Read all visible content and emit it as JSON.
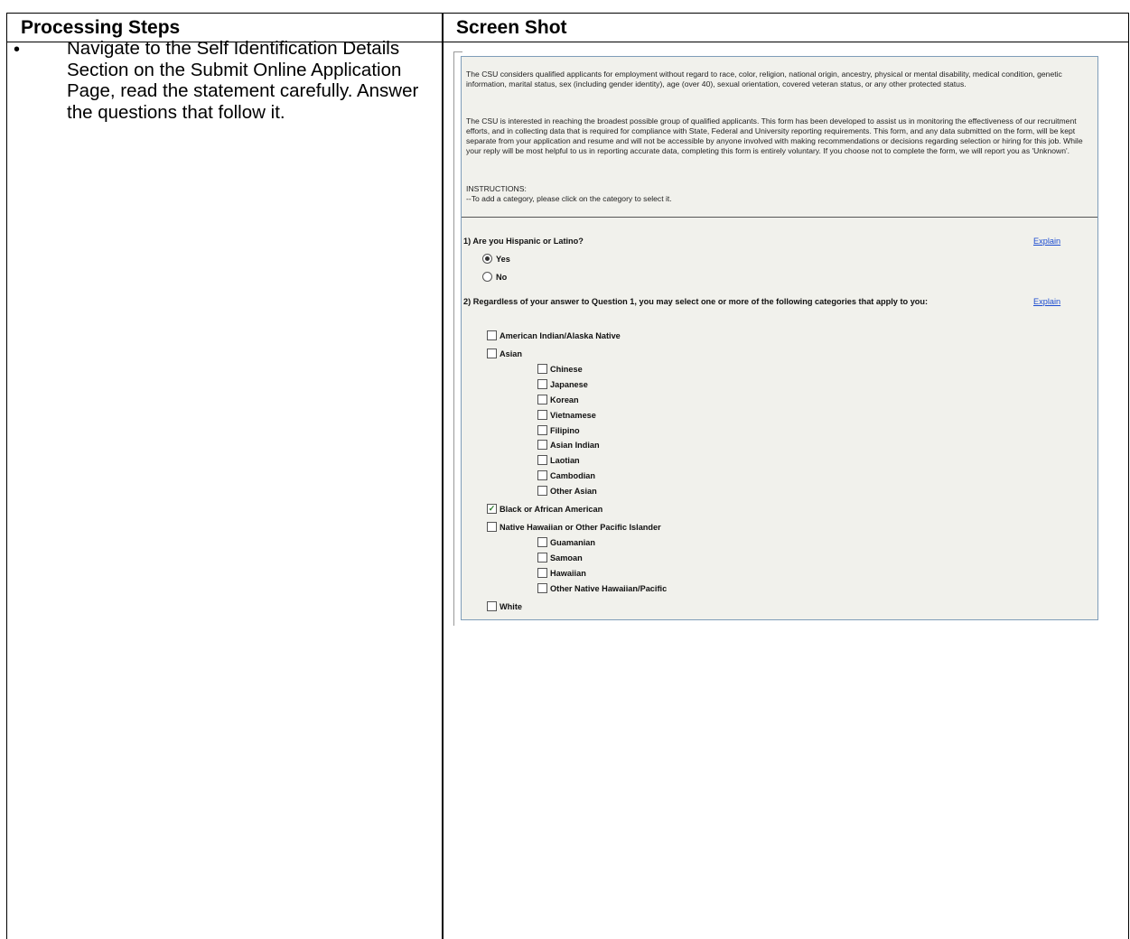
{
  "table": {
    "header_left": "Processing Steps",
    "header_right": "Screen Shot"
  },
  "step": {
    "bullet": "•",
    "text": "Navigate to the Self Identification Details Section on the Submit Online Application Page, read the statement carefully.  Answer the questions that follow it."
  },
  "form": {
    "intro_1": "The CSU considers qualified applicants for employment without regard to race, color, religion, national origin, ancestry, physical or mental disability, medical condition, genetic information, marital status, sex (including gender identity), age (over 40), sexual orientation, covered veteran status, or any other protected status.",
    "intro_2": "The CSU is interested in reaching the broadest possible group of qualified applicants. This form has been developed to assist us in monitoring the effectiveness of our recruitment efforts, and in collecting data that is required for compliance with State, Federal and University reporting requirements. This form, and any data submitted on the form, will be kept separate from your application and resume and will not be accessible by anyone involved with making recommendations or decisions regarding selection or hiring for this job. While your reply will be most helpful to us in reporting accurate data, completing this form is entirely voluntary. If you choose not to complete the form, we will report you as 'Unknown'.",
    "instructions_title": "INSTRUCTIONS:",
    "instructions_text": "--To add a category, please click on the category to select it.",
    "q1": {
      "label": "1) Are you Hispanic or Latino?",
      "explain": "Explain",
      "options": [
        {
          "label": "Yes",
          "selected": true
        },
        {
          "label": "No",
          "selected": false
        }
      ]
    },
    "q2": {
      "label": "2) Regardless of your answer to Question 1, you may select one or more of the following categories that apply to you:",
      "explain": "Explain",
      "categories": [
        {
          "label": "American Indian/Alaska Native",
          "checked": false
        },
        {
          "label": "Asian",
          "checked": false
        },
        {
          "label": "Chinese",
          "checked": false
        },
        {
          "label": "Japanese",
          "checked": false
        },
        {
          "label": "Korean",
          "checked": false
        },
        {
          "label": "Vietnamese",
          "checked": false
        },
        {
          "label": "Filipino",
          "checked": false
        },
        {
          "label": "Asian Indian",
          "checked": false
        },
        {
          "label": "Laotian",
          "checked": false
        },
        {
          "label": "Cambodian",
          "checked": false
        },
        {
          "label": "Other Asian",
          "checked": false
        },
        {
          "label": "Black or African American",
          "checked": true
        },
        {
          "label": "Native Hawaiian or Other Pacific Islander",
          "checked": false
        },
        {
          "label": "Guamanian",
          "checked": false
        },
        {
          "label": "Samoan",
          "checked": false
        },
        {
          "label": "Hawaiian",
          "checked": false
        },
        {
          "label": "Other Native Hawaiian/Pacific",
          "checked": false
        },
        {
          "label": "White",
          "checked": false
        }
      ]
    }
  }
}
